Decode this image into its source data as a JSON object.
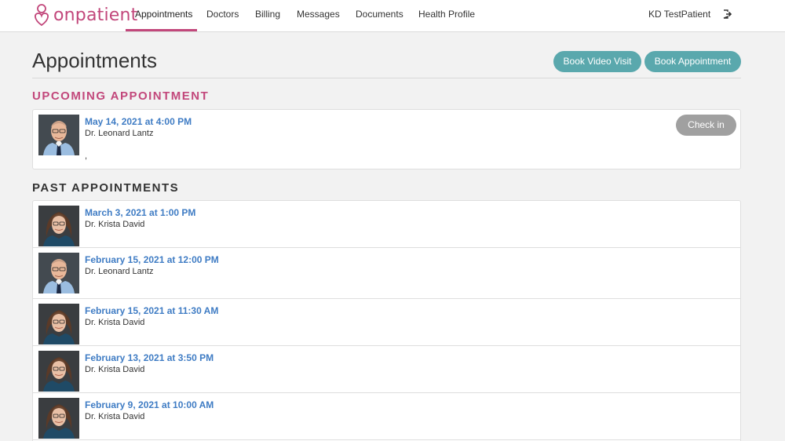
{
  "brand": {
    "name": "onpatient",
    "color": "#c2477b"
  },
  "nav": {
    "items": [
      {
        "label": "Appointments",
        "active": true
      },
      {
        "label": "Doctors"
      },
      {
        "label": "Billing"
      },
      {
        "label": "Messages"
      },
      {
        "label": "Documents"
      },
      {
        "label": "Health Profile"
      }
    ],
    "user": "KD TestPatient",
    "logout_icon": "sign-out-icon"
  },
  "page": {
    "title": "Appointments",
    "book_video_label": "Book Video Visit",
    "book_appt_label": "Book Appointment",
    "accent_button_color": "#5aa8ad"
  },
  "upcoming": {
    "heading": "Upcoming Appointment",
    "date": "May 14, 2021 at 4:00 PM",
    "doctor": "Dr. Leonard Lantz",
    "extra": ",",
    "checkin_label": "Check in"
  },
  "past": {
    "heading": "Past Appointments",
    "items": [
      {
        "date": "March 3, 2021 at 1:00 PM",
        "doctor": "Dr. Krista David"
      },
      {
        "date": "February 15, 2021 at 12:00 PM",
        "doctor": "Dr. Leonard Lantz"
      },
      {
        "date": "February 15, 2021 at 11:30 AM",
        "doctor": "Dr. Krista David"
      },
      {
        "date": "February 13, 2021 at 3:50 PM",
        "doctor": "Dr. Krista David"
      },
      {
        "date": "February 9, 2021 at 10:00 AM",
        "doctor": "Dr. Krista David"
      }
    ]
  }
}
